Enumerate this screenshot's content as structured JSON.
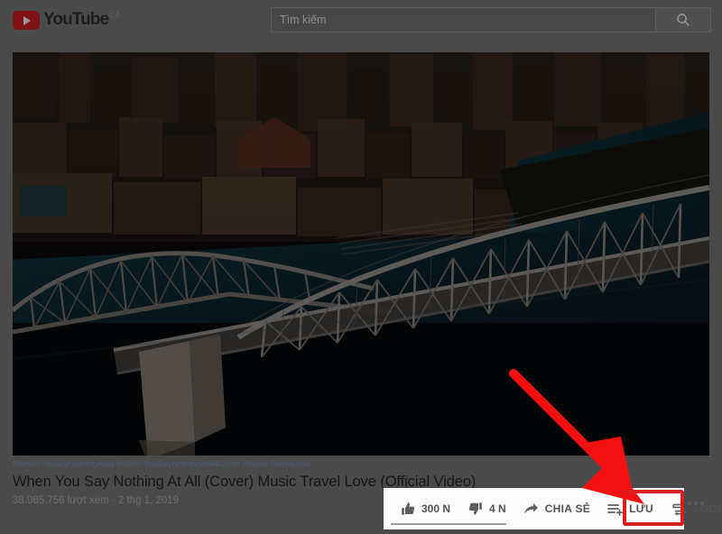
{
  "header": {
    "logo_word": "YouTube",
    "logo_country": "CA",
    "logo_icon": "youtube-play-icon",
    "search_placeholder": "Tìm kiếm",
    "search_value": "",
    "search_icon": "search-icon"
  },
  "video": {
    "description": "Aerial view of a steel truss bridge over a river at dusk with a city skyline",
    "hashtags": "#WhenYouSayNothingAtAll #WhenYouSayNothingAtAllCover #MusicTravelLove",
    "title": "When You Say Nothing At All (Cover) Music Travel Love (Official Video)",
    "views": "38.085.756 lượt xem",
    "separator": "·",
    "date": "2 thg 1, 2019",
    "meta_line": "38.085.756 lượt xem · 2 thg 1, 2019"
  },
  "actions": {
    "like": {
      "label": "300 N",
      "icon": "thumbs-up-icon"
    },
    "dislike": {
      "label": "4 N",
      "icon": "thumbs-down-icon"
    },
    "share": {
      "label": "CHIA SẺ",
      "icon": "share-arrow-icon"
    },
    "save": {
      "label": "LƯU",
      "icon": "playlist-add-icon"
    },
    "loop": {
      "label": "LOOP",
      "icon": "loop-repeat-icon"
    },
    "more": {
      "label": "",
      "icon": "more-horizontal-icon"
    }
  },
  "annotation": {
    "highlight_color": "#d81f1f",
    "arrow_color": "#f41010",
    "target": "LOOP"
  },
  "colors": {
    "page_background": "#4a4a4a",
    "panel_background": "#fbfbfb",
    "brand_red": "#7e1214",
    "link_blue": "#4a5a72"
  }
}
